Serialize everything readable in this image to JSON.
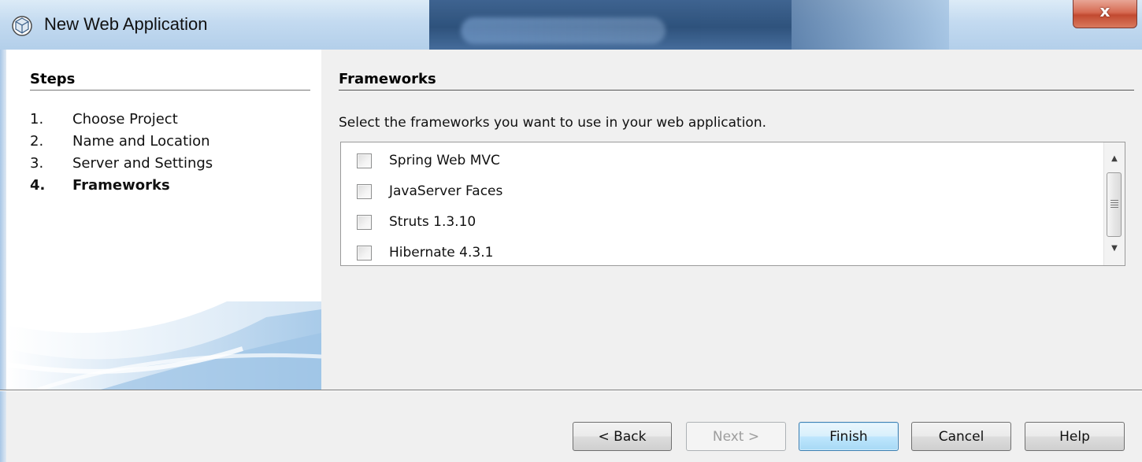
{
  "window": {
    "title": "New Web Application",
    "icon": "netbeans-cube-icon",
    "close_label": "x"
  },
  "steps": {
    "title": "Steps",
    "items": [
      {
        "num": "1.",
        "label": "Choose Project",
        "current": false
      },
      {
        "num": "2.",
        "label": "Name and Location",
        "current": false
      },
      {
        "num": "3.",
        "label": "Server and Settings",
        "current": false
      },
      {
        "num": "4.",
        "label": "Frameworks",
        "current": true
      }
    ]
  },
  "frameworks": {
    "title": "Frameworks",
    "description": "Select the frameworks you want to use in your web application.",
    "items": [
      {
        "label": "Spring Web MVC",
        "checked": false
      },
      {
        "label": "JavaServer Faces",
        "checked": false
      },
      {
        "label": "Struts 1.3.10",
        "checked": false
      },
      {
        "label": "Hibernate 4.3.1",
        "checked": false
      }
    ]
  },
  "buttons": {
    "back": "< Back",
    "next": "Next >",
    "finish": "Finish",
    "cancel": "Cancel",
    "help": "Help"
  },
  "colors": {
    "default_button_border": "#3c7fb1",
    "close_button": "#c24a31",
    "panel_white": "#ffffff"
  }
}
